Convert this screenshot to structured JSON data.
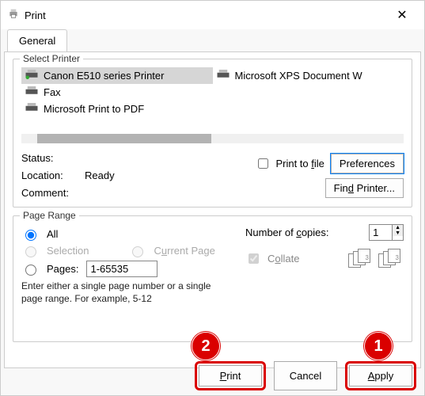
{
  "window": {
    "title": "Print"
  },
  "tabs": {
    "general": "General"
  },
  "select_printer": {
    "label": "Select Printer",
    "printers": [
      {
        "name": "Canon E510 series Printer",
        "selected": true
      },
      {
        "name": "Microsoft XPS Document W",
        "selected": false
      },
      {
        "name": "Fax",
        "selected": false
      },
      {
        "name": "Microsoft Print to PDF",
        "selected": false
      }
    ]
  },
  "status": {
    "status_label": "Status:",
    "status_value": "Ready",
    "location_label": "Location:",
    "location_value": "",
    "comment_label": "Comment:",
    "comment_value": "",
    "print_to_file": "Print to file",
    "preferences": "Preferences",
    "find_printer": "Find Printer..."
  },
  "page_range": {
    "label": "Page Range",
    "all": "All",
    "selection": "Selection",
    "current_page": "Current Page",
    "pages": "Pages:",
    "pages_value": "1-65535",
    "hint": "Enter either a single page number or a single page range.  For example, 5-12"
  },
  "copies": {
    "number_label": "Number of copies:",
    "number_value": "1",
    "collate": "Collate"
  },
  "footer": {
    "print": "Print",
    "cancel": "Cancel",
    "apply": "Apply"
  },
  "callouts": {
    "one": "1",
    "two": "2"
  }
}
